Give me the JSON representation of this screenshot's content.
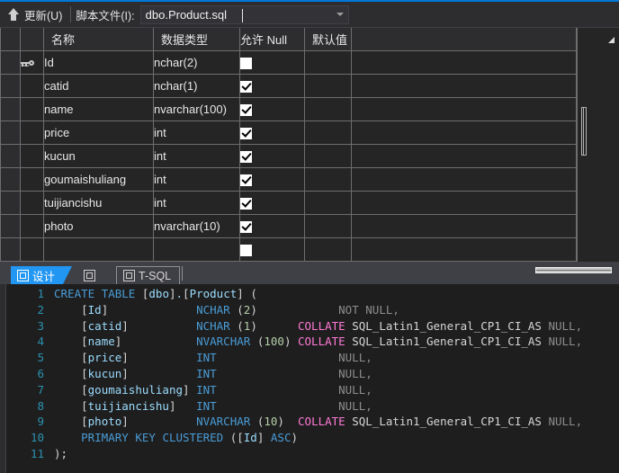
{
  "window": {
    "accent_color": "#0078d7"
  },
  "toolbar": {
    "update_button_label": "更新(U)",
    "update_icon": "up-arrow-icon",
    "script_file_label": "脚本文件(I):",
    "script_file_value": "dbo.Product.sql",
    "dropdown_icon": "chevron-down-icon"
  },
  "grid": {
    "headers": {
      "name": "名称",
      "data_type": "数据类型",
      "allow_null": "允许 Null",
      "default_value": "默认值"
    },
    "rows": [
      {
        "key": true,
        "name": "Id",
        "type": "nchar(2)",
        "allow_null": false,
        "default": ""
      },
      {
        "key": false,
        "name": "catid",
        "type": "nchar(1)",
        "allow_null": true,
        "default": ""
      },
      {
        "key": false,
        "name": "name",
        "type": "nvarchar(100)",
        "allow_null": true,
        "default": ""
      },
      {
        "key": false,
        "name": "price",
        "type": "int",
        "allow_null": true,
        "default": ""
      },
      {
        "key": false,
        "name": "kucun",
        "type": "int",
        "allow_null": true,
        "default": ""
      },
      {
        "key": false,
        "name": "goumaishuliang",
        "type": "int",
        "allow_null": true,
        "default": ""
      },
      {
        "key": false,
        "name": "tuijiancishu",
        "type": "int",
        "allow_null": true,
        "default": ""
      },
      {
        "key": false,
        "name": "photo",
        "type": "nvarchar(10)",
        "allow_null": true,
        "default": ""
      },
      {
        "key": false,
        "name": "",
        "type": "",
        "allow_null": false,
        "default": ""
      }
    ]
  },
  "tabs": {
    "design_label": "设计",
    "design_icon": "design-view-icon",
    "middle_icon": "diagram-icon",
    "tsql_label": "T-SQL",
    "tsql_icon": "tsql-icon",
    "active": "设计"
  },
  "editor": {
    "lines": [
      {
        "n": "1",
        "text": "CREATE TABLE [dbo].[Product] ("
      },
      {
        "n": "2",
        "text": "    [Id]             NCHAR (2)            NOT NULL,"
      },
      {
        "n": "3",
        "text": "    [catid]          NCHAR (1)      COLLATE SQL_Latin1_General_CP1_CI_AS NULL,"
      },
      {
        "n": "4",
        "text": "    [name]           NVARCHAR (100) COLLATE SQL_Latin1_General_CP1_CI_AS NULL,"
      },
      {
        "n": "5",
        "text": "    [price]          INT                  NULL,"
      },
      {
        "n": "6",
        "text": "    [kucun]          INT                  NULL,"
      },
      {
        "n": "7",
        "text": "    [goumaishuliang] INT                  NULL,"
      },
      {
        "n": "8",
        "text": "    [tuijiancishu]   INT                  NULL,"
      },
      {
        "n": "9",
        "text": "    [photo]          NVARCHAR (10)  COLLATE SQL_Latin1_General_CP1_CI_AS NULL,"
      },
      {
        "n": "10",
        "text": "    PRIMARY KEY CLUSTERED ([Id] ASC)"
      },
      {
        "n": "11",
        "text": ");"
      }
    ]
  }
}
